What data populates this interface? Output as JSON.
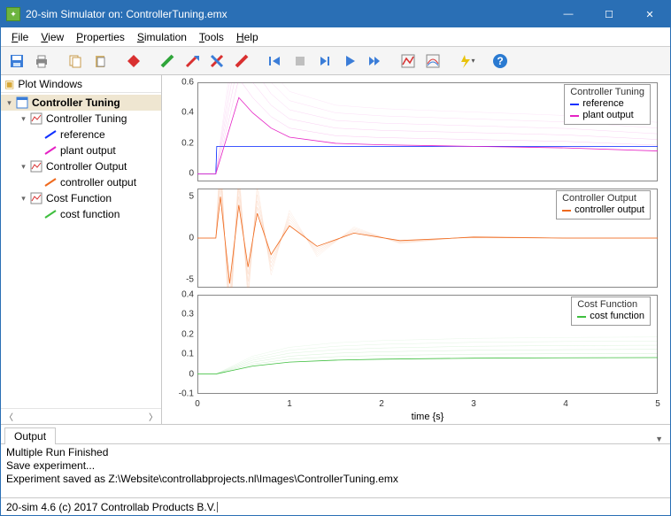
{
  "window": {
    "title": "20-sim Simulator on: ControllerTuning.emx"
  },
  "menu": [
    "File",
    "View",
    "Properties",
    "Simulation",
    "Tools",
    "Help"
  ],
  "side": {
    "header": "Plot Windows",
    "tree": [
      {
        "label": "Controller Tuning",
        "depth": 0,
        "twist": "▾",
        "icon": "window",
        "selected": true,
        "bold": true
      },
      {
        "label": "Controller Tuning",
        "depth": 1,
        "twist": "▾",
        "icon": "chart"
      },
      {
        "label": "reference",
        "depth": 2,
        "twist": "",
        "icon": "line-blue"
      },
      {
        "label": "plant output",
        "depth": 2,
        "twist": "",
        "icon": "line-magenta"
      },
      {
        "label": "Controller Output",
        "depth": 1,
        "twist": "▾",
        "icon": "chart"
      },
      {
        "label": "controller output",
        "depth": 2,
        "twist": "",
        "icon": "line-orange"
      },
      {
        "label": "Cost Function",
        "depth": 1,
        "twist": "▾",
        "icon": "chart"
      },
      {
        "label": "cost function",
        "depth": 2,
        "twist": "",
        "icon": "line-green"
      }
    ]
  },
  "legends": {
    "p1": {
      "title": "Controller Tuning",
      "items": [
        {
          "name": "reference",
          "color": "#1030ff"
        },
        {
          "name": "plant output",
          "color": "#e522c4"
        }
      ]
    },
    "p2": {
      "title": "Controller Output",
      "items": [
        {
          "name": "controller output",
          "color": "#ef6a1e"
        }
      ]
    },
    "p3": {
      "title": "Cost Function",
      "items": [
        {
          "name": "cost function",
          "color": "#3fbf3f"
        }
      ]
    }
  },
  "xlabel": "time {s}",
  "output_tab": "Output",
  "console": [
    "Multiple Run Finished",
    "Save experiment...",
    "Experiment saved as Z:\\Website\\controllabprojects.nl\\Images\\ControllerTuning.emx"
  ],
  "status": "20-sim 4.6 (c) 2017 Controllab Products B.V.",
  "chart_data": [
    {
      "type": "line",
      "title": "Controller Tuning",
      "xlabel": "time {s}",
      "ylabel": "",
      "xlim": [
        0,
        5
      ],
      "ylim": [
        -0.05,
        0.6
      ],
      "yticks": [
        0,
        0.2,
        0.4,
        0.6
      ],
      "note": "multiple overlaid runs (ensemble); values are approximate envelope of final run",
      "series": [
        {
          "name": "reference",
          "color": "#1030ff",
          "x": [
            0,
            0.2,
            0.21,
            5
          ],
          "y": [
            0,
            0,
            0.18,
            0.18
          ]
        },
        {
          "name": "plant output",
          "color": "#e522c4",
          "x": [
            0,
            0.2,
            0.3,
            0.45,
            0.6,
            0.8,
            1.0,
            1.5,
            2.0,
            3.0,
            4.0,
            5.0
          ],
          "y": [
            0,
            0,
            0.2,
            0.5,
            0.4,
            0.3,
            0.24,
            0.2,
            0.19,
            0.18,
            0.17,
            0.15
          ]
        }
      ]
    },
    {
      "type": "line",
      "title": "Controller Output",
      "xlabel": "time {s}",
      "ylabel": "",
      "xlim": [
        0,
        5
      ],
      "ylim": [
        -6,
        6
      ],
      "yticks": [
        -5,
        0,
        5
      ],
      "note": "damped oscillation ensemble, values approximate",
      "series": [
        {
          "name": "controller output",
          "color": "#ef6a1e",
          "x": [
            0,
            0.2,
            0.25,
            0.35,
            0.45,
            0.55,
            0.65,
            0.8,
            1.0,
            1.3,
            1.7,
            2.2,
            3.0,
            4.0,
            5.0
          ],
          "y": [
            0,
            0,
            5.0,
            -5.5,
            4.0,
            -3.5,
            3.0,
            -2.0,
            1.5,
            -1.0,
            0.6,
            -0.3,
            0.1,
            0.0,
            0.0
          ]
        }
      ]
    },
    {
      "type": "line",
      "title": "Cost Function",
      "xlabel": "time {s}",
      "ylabel": "",
      "xlim": [
        0,
        5
      ],
      "ylim": [
        -0.1,
        0.4
      ],
      "yticks": [
        -0.1,
        0,
        0.1,
        0.2,
        0.3,
        0.4
      ],
      "note": "monotone cost curves ensemble, values approximate",
      "series": [
        {
          "name": "cost function",
          "color": "#3fbf3f",
          "x": [
            0,
            0.2,
            0.4,
            0.6,
            1.0,
            1.5,
            2.0,
            3.0,
            4.0,
            5.0
          ],
          "y": [
            0,
            0,
            0.02,
            0.04,
            0.06,
            0.07,
            0.075,
            0.08,
            0.082,
            0.083
          ]
        }
      ]
    }
  ]
}
